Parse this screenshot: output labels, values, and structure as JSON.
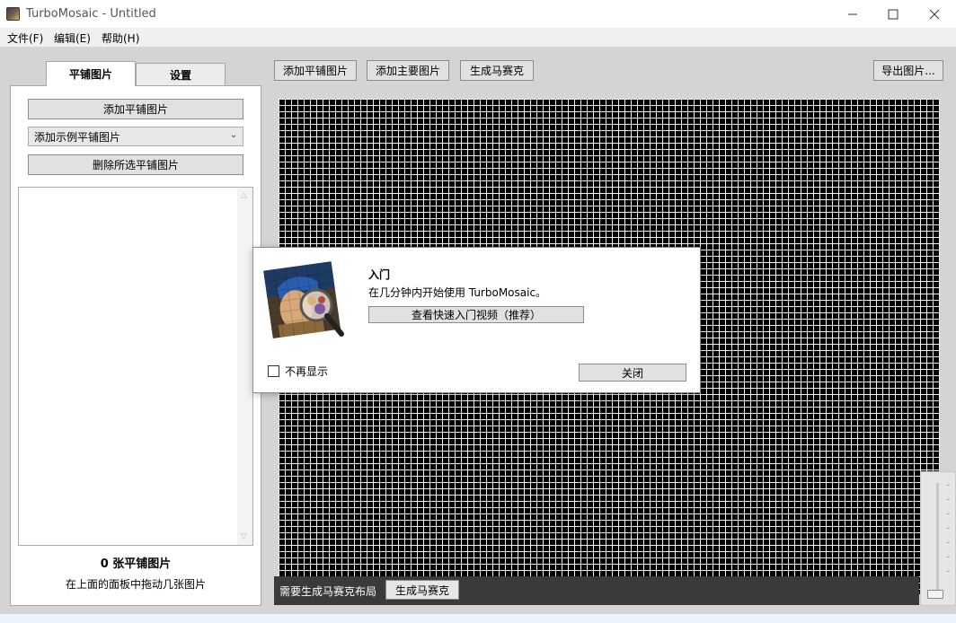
{
  "window": {
    "title": "TurboMosaic - Untitled",
    "minimize_glyph": "minimize-icon",
    "maximize_glyph": "maximize-icon",
    "close_glyph": "close-icon"
  },
  "menu": [
    "文件(F)",
    "编辑(E)",
    "帮助(H)"
  ],
  "tabs": [
    {
      "label": "平铺图片",
      "active": true
    },
    {
      "label": "设置",
      "active": false
    }
  ],
  "left_panel": {
    "add_tiles_button": "添加平铺图片",
    "sample_tiles_select": "添加示例平铺图片",
    "delete_button": "删除所选平铺图片",
    "tile_count": "0 张平铺图片",
    "hint": "在上面的面板中拖动几张图片"
  },
  "toolbar": {
    "add_tiles": "添加平铺图片",
    "add_main": "添加主要图片",
    "generate": "生成马赛克",
    "export": "导出图片..."
  },
  "status": {
    "message": "需要生成马赛克布局",
    "generate_button": "生成马赛克"
  },
  "dialog": {
    "title": "入门",
    "subtitle": "在几分钟内开始使用 TurboMosaic。",
    "video_button": "查看快速入门视频（推荐）",
    "dont_show_label": "不再显示",
    "dont_show_checked": false,
    "close_button": "关闭"
  },
  "colors": {
    "work_bg": "#d4d4d4",
    "grid_bg": "#000000",
    "grid_line": "#ffffff",
    "status_bg": "#3a3a3a"
  }
}
